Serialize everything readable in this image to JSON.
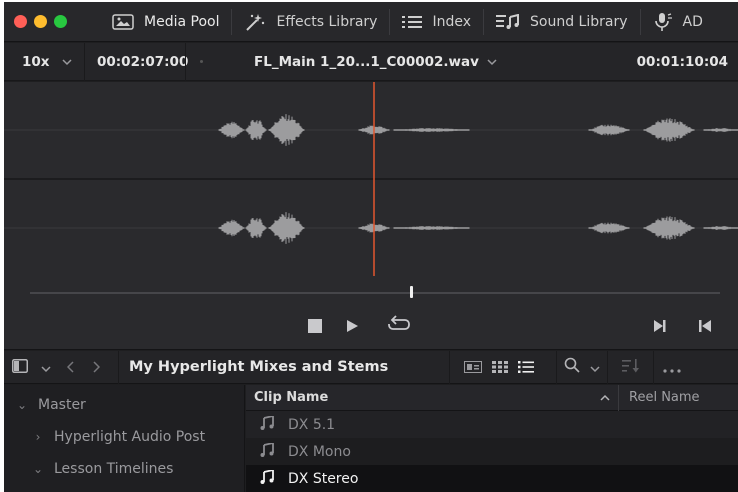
{
  "toolbar": {
    "traffic_lights": [
      "#ff5f57",
      "#febc2e",
      "#28c840"
    ],
    "items": [
      {
        "label": "Media Pool",
        "icon": "media-pool-icon"
      },
      {
        "label": "Effects Library",
        "icon": "effects-wand-icon"
      },
      {
        "label": "Index",
        "icon": "index-list-icon"
      },
      {
        "label": "Sound Library",
        "icon": "sound-library-icon"
      },
      {
        "label": "AD",
        "icon": "adr-microphone-icon"
      }
    ]
  },
  "viewer": {
    "zoom": "10x",
    "timecode_left": "00:02:07:00",
    "clip_name": "FL_Main 1_20...1_C00002.wav",
    "timecode_right": "00:01:10:04",
    "playhead_color": "#e2562e",
    "waveform_color": "#9c9c9e"
  },
  "transport": {
    "scrubber_position": 0.55,
    "buttons": [
      "stop-icon",
      "play-icon",
      "loop-icon",
      "next-frame-icon",
      "prev-frame-icon"
    ]
  },
  "media_pool": {
    "bin_title": "My Hyperlight Mixes and Stems",
    "bins": [
      {
        "label": "Master",
        "expanded": true,
        "indent": 0
      },
      {
        "label": "Hyperlight Audio Post",
        "expanded": false,
        "indent": 1
      },
      {
        "label": "Lesson Timelines",
        "expanded": true,
        "indent": 1
      }
    ],
    "columns": {
      "clip_name": "Clip Name",
      "reel_name": "Reel Name"
    },
    "clips": [
      {
        "name": "DX 5.1",
        "selected": false
      },
      {
        "name": "DX Mono",
        "selected": false
      },
      {
        "name": "DX Stereo",
        "selected": true
      }
    ]
  }
}
